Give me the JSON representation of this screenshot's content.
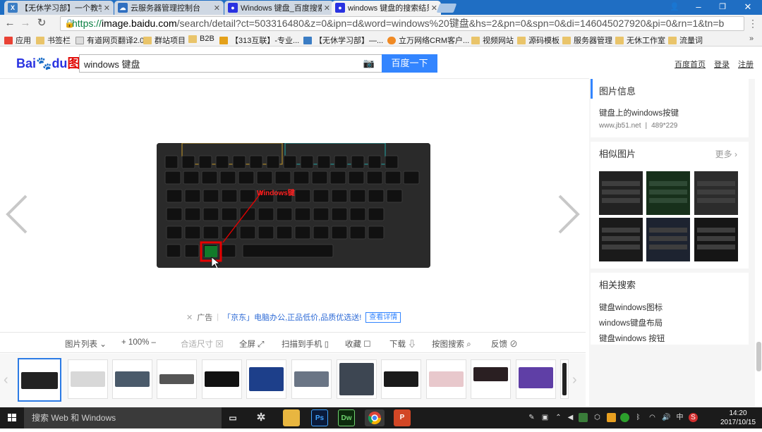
{
  "browser": {
    "tabs": [
      {
        "title": "【无休学习部】一个教学",
        "icon": "X"
      },
      {
        "title": "云服务器管理控制台",
        "icon": "cloud"
      },
      {
        "title": "Windows 键盘_百度搜索",
        "icon": "paw"
      },
      {
        "title": "windows 键盘的搜索结果",
        "icon": "paw",
        "active": true
      }
    ],
    "window_controls": {
      "user": "user-icon",
      "minimize": "–",
      "restore": "❐",
      "close": "✕"
    },
    "url": {
      "scheme": "https://",
      "host": "image.baidu.com",
      "path": "/search/detail?ct=503316480&z=0&ipn=d&word=windows%20键盘&hs=2&pn=0&spn=0&di=146045027920&pi=0&rn=1&tn=b"
    },
    "bookmarks": [
      "应用",
      "书签栏",
      "有道网页翻译2.0",
      "群站项目",
      "B2B",
      "【313互联】-专业...",
      "【无休学习部】—...",
      "立万网络CRM客户...",
      "视频网站",
      "源码模板",
      "服务器管理",
      "无休工作室",
      "流量词"
    ]
  },
  "baidu": {
    "logo": {
      "bai": "Bai",
      "du": "du",
      "image": "图片"
    },
    "search_value": "windows 键盘",
    "search_button": "百度一下",
    "top_links": [
      "百度首页",
      "登录",
      "注册"
    ]
  },
  "viewer": {
    "keyboard_overlay_label": "Windows键",
    "ad": {
      "label": "广告",
      "brand": "「京东」",
      "text": "电脑办公,正品低价,品质优选送!",
      "button": "查看详情"
    },
    "controls": [
      {
        "label": "图片列表",
        "icon": "⌄"
      },
      {
        "label": "100%",
        "prefix": "+",
        "suffix": "–"
      },
      {
        "label": "合适尺寸",
        "icon": "⊠",
        "disabled": true
      },
      {
        "label": "全屏",
        "icon": "⤢"
      },
      {
        "label": "扫描到手机",
        "icon": "▯"
      },
      {
        "label": "收藏",
        "icon": "☐"
      },
      {
        "label": "下载",
        "icon": "⇩"
      },
      {
        "label": "按图搜索",
        "icon": "⌕"
      },
      {
        "label": "反馈",
        "icon": "⊘"
      }
    ]
  },
  "sidebar": {
    "info": {
      "title": "图片信息",
      "caption": "键盘上的windows按键",
      "source": "www.jb51.net",
      "separator": "|",
      "size": "489*229"
    },
    "similar": {
      "title": "相似图片",
      "more": "更多"
    },
    "related": {
      "title": "相关搜索",
      "items": [
        "键盘windows图标",
        "windows键盘布局",
        "键盘windows 按钮"
      ]
    }
  },
  "taskbar": {
    "search_placeholder": "搜索 Web 和 Windows",
    "apps": [
      "task-view-icon",
      "pinwheel-icon",
      "file-explorer-icon",
      "Ps",
      "Dw",
      "chrome-icon",
      "powerpoint-icon"
    ],
    "tray_ime": "中",
    "time": "14:20",
    "date": "2017/10/15"
  },
  "colors": {
    "accent": "#3385ff",
    "tab_bar": "#1f6ec3",
    "taskbar": "#1b1b1b"
  }
}
